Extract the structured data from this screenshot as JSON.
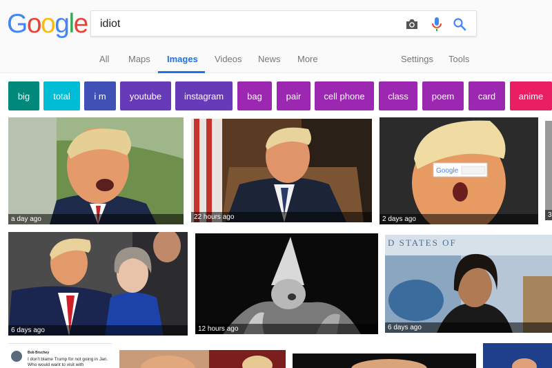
{
  "search": {
    "query": "idiot"
  },
  "logo": {
    "letters": [
      "G",
      "o",
      "o",
      "g",
      "l",
      "e"
    ],
    "colors": [
      "#4285f4",
      "#ea4335",
      "#fbbc05",
      "#4285f4",
      "#34a853",
      "#ea4335"
    ]
  },
  "tabs": {
    "all": "All",
    "maps": "Maps",
    "images": "Images",
    "videos": "Videos",
    "news": "News",
    "more": "More",
    "settings": "Settings",
    "tools": "Tools"
  },
  "chips": [
    {
      "label": "big",
      "color": "#00897b"
    },
    {
      "label": "total",
      "color": "#00bcd4"
    },
    {
      "label": "i m",
      "color": "#3f51b5"
    },
    {
      "label": "youtube",
      "color": "#673ab7"
    },
    {
      "label": "instagram",
      "color": "#673ab7"
    },
    {
      "label": "bag",
      "color": "#9c27b0"
    },
    {
      "label": "pair",
      "color": "#9c27b0"
    },
    {
      "label": "cell phone",
      "color": "#9c27b0"
    },
    {
      "label": "class",
      "color": "#9c27b0"
    },
    {
      "label": "poem",
      "color": "#9c27b0"
    },
    {
      "label": "card",
      "color": "#9c27b0"
    },
    {
      "label": "anime",
      "color": "#e91e63"
    }
  ],
  "results": [
    {
      "age": "a day ago"
    },
    {
      "age": "22 hours ago"
    },
    {
      "age": "2 days ago"
    },
    {
      "age": "3"
    },
    {
      "age": "6 days ago"
    },
    {
      "age": "12 hours ago"
    },
    {
      "age": "6 days ago"
    }
  ],
  "embedded_text": {
    "google_overlay": "Google",
    "sign": "D STATES OF"
  },
  "tweet": {
    "name": "Bob Bruchey",
    "text": "I don't blame Trump for not going in Jan. Who would want to visit with"
  }
}
